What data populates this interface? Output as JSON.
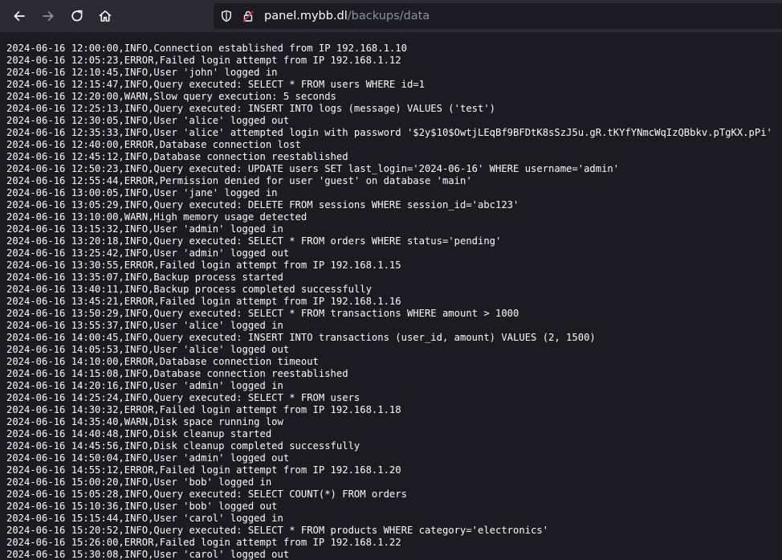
{
  "browser": {
    "url_domain": "panel.mybb.dl",
    "url_path": "/backups/data",
    "icons": {
      "back": "arrow-left-icon",
      "forward": "arrow-right-icon",
      "reload": "reload-icon",
      "home": "home-icon",
      "tracking": "shield-icon",
      "insecure": "insecure-lock-icon"
    },
    "colors": {
      "toolbar": "#2b2a33",
      "page": "#1c1b22",
      "text": "#fbfbfe",
      "muted": "#8f8f9d"
    }
  },
  "log_lines": [
    "2024-06-16 12:00:00,INFO,Connection established from IP 192.168.1.10",
    "2024-06-16 12:05:23,ERROR,Failed login attempt from IP 192.168.1.12",
    "2024-06-16 12:10:45,INFO,User 'john' logged in",
    "2024-06-16 12:15:47,INFO,Query executed: SELECT * FROM users WHERE id=1",
    "2024-06-16 12:20:00,WARN,Slow query execution: 5 seconds",
    "2024-06-16 12:25:13,INFO,Query executed: INSERT INTO logs (message) VALUES ('test')",
    "2024-06-16 12:30:05,INFO,User 'alice' logged out",
    "2024-06-16 12:35:33,INFO,User 'alice' attempted login with password '$2y$10$OwtjLEqBf9BFDtK8sSzJ5u.gR.tKYfYNmcWqIzQBbkv.pTgKX.pPi'",
    "2024-06-16 12:40:00,ERROR,Database connection lost",
    "2024-06-16 12:45:12,INFO,Database connection reestablished",
    "2024-06-16 12:50:23,INFO,Query executed: UPDATE users SET last_login='2024-06-16' WHERE username='admin'",
    "2024-06-16 12:55:44,ERROR,Permission denied for user 'guest' on database 'main'",
    "2024-06-16 13:00:05,INFO,User 'jane' logged in",
    "2024-06-16 13:05:29,INFO,Query executed: DELETE FROM sessions WHERE session_id='abc123'",
    "2024-06-16 13:10:00,WARN,High memory usage detected",
    "2024-06-16 13:15:32,INFO,User 'admin' logged in",
    "2024-06-16 13:20:18,INFO,Query executed: SELECT * FROM orders WHERE status='pending'",
    "2024-06-16 13:25:42,INFO,User 'admin' logged out",
    "2024-06-16 13:30:55,ERROR,Failed login attempt from IP 192.168.1.15",
    "2024-06-16 13:35:07,INFO,Backup process started",
    "2024-06-16 13:40:11,INFO,Backup process completed successfully",
    "2024-06-16 13:45:21,ERROR,Failed login attempt from IP 192.168.1.16",
    "2024-06-16 13:50:29,INFO,Query executed: SELECT * FROM transactions WHERE amount > 1000",
    "2024-06-16 13:55:37,INFO,User 'alice' logged in",
    "2024-06-16 14:00:45,INFO,Query executed: INSERT INTO transactions (user_id, amount) VALUES (2, 1500)",
    "2024-06-16 14:05:53,INFO,User 'alice' logged out",
    "2024-06-16 14:10:00,ERROR,Database connection timeout",
    "2024-06-16 14:15:08,INFO,Database connection reestablished",
    "2024-06-16 14:20:16,INFO,User 'admin' logged in",
    "2024-06-16 14:25:24,INFO,Query executed: SELECT * FROM users",
    "2024-06-16 14:30:32,ERROR,Failed login attempt from IP 192.168.1.18",
    "2024-06-16 14:35:40,WARN,Disk space running low",
    "2024-06-16 14:40:48,INFO,Disk cleanup started",
    "2024-06-16 14:45:56,INFO,Disk cleanup completed successfully",
    "2024-06-16 14:50:04,INFO,User 'admin' logged out",
    "2024-06-16 14:55:12,ERROR,Failed login attempt from IP 192.168.1.20",
    "2024-06-16 15:00:20,INFO,User 'bob' logged in",
    "2024-06-16 15:05:28,INFO,Query executed: SELECT COUNT(*) FROM orders",
    "2024-06-16 15:10:36,INFO,User 'bob' logged out",
    "2024-06-16 15:15:44,INFO,User 'carol' logged in",
    "2024-06-16 15:20:52,INFO,Query executed: SELECT * FROM products WHERE category='electronics'",
    "2024-06-16 15:26:00,ERROR,Failed login attempt from IP 192.168.1.22",
    "2024-06-16 15:30:08,INFO,User 'carol' logged out"
  ]
}
